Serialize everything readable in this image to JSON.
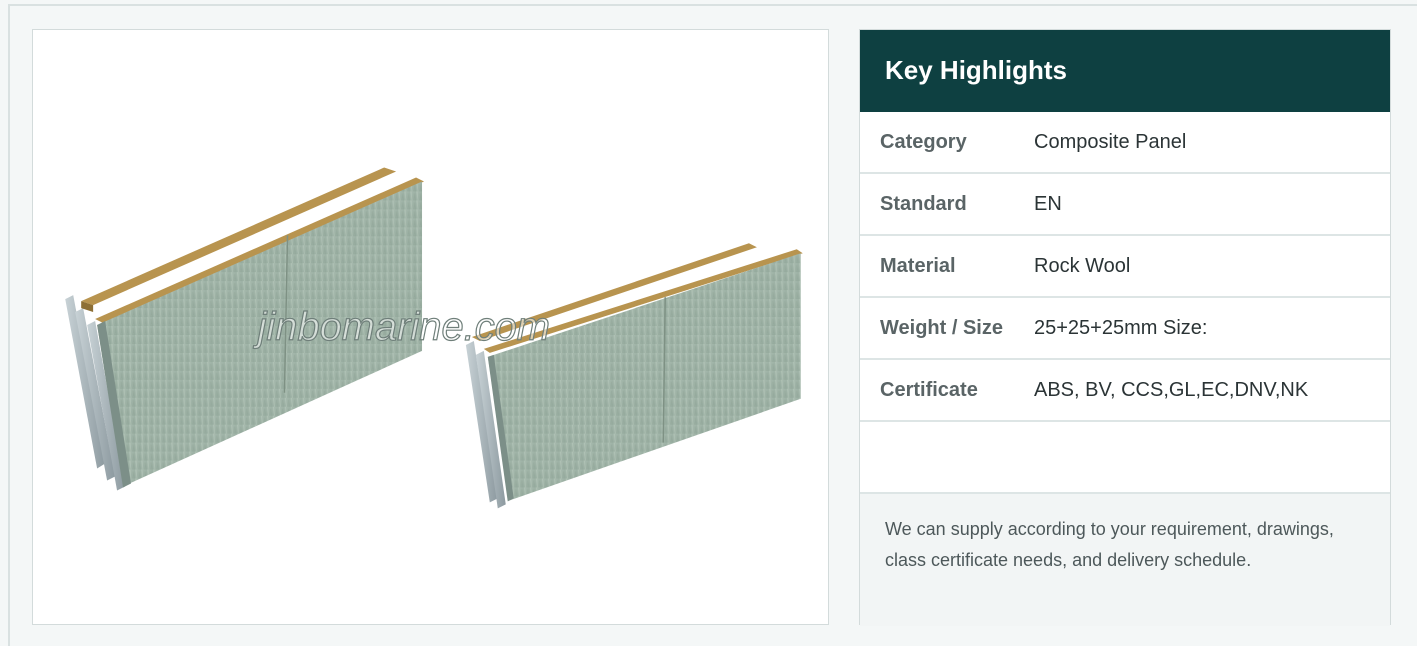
{
  "image": {
    "watermark": "jinbomarine.com",
    "alt": "Composite rock wool panels"
  },
  "highlights": {
    "title": "Key Highlights",
    "rows": [
      {
        "label": "Category",
        "value": "Composite Panel"
      },
      {
        "label": "Standard",
        "value": "EN"
      },
      {
        "label": "Material",
        "value": "Rock Wool"
      },
      {
        "label": "Weight / Size",
        "value": "25+25+25mm Size:"
      },
      {
        "label": "Certificate",
        "value": "ABS, BV, CCS,GL,EC,DNV,NK"
      }
    ],
    "note": "We can supply according to your requirement, drawings, class certificate needs, and delivery schedule."
  },
  "colors": {
    "header_bg": "#0e4041",
    "panel_face": "#9fb3a7",
    "rock_wool": "#b8944f"
  }
}
